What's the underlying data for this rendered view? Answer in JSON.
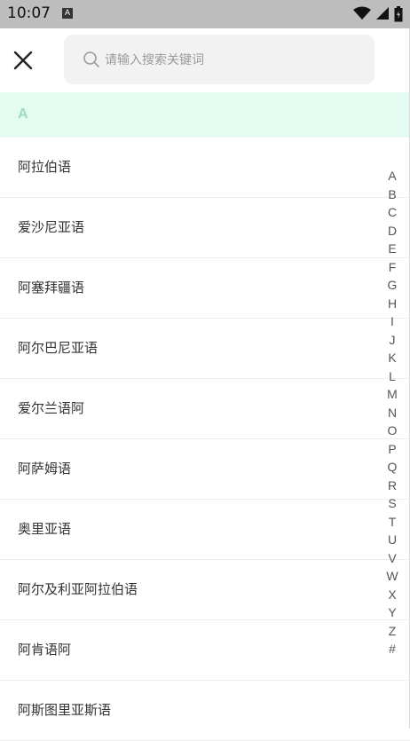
{
  "status_bar": {
    "time": "10:07",
    "notification_glyph": "A"
  },
  "search": {
    "placeholder": "请输入搜索关键词"
  },
  "section": {
    "letter": "A"
  },
  "languages": [
    "阿拉伯语",
    "爱沙尼亚语",
    "阿塞拜疆语",
    "阿尔巴尼亚语",
    "爱尔兰语阿",
    "阿萨姆语",
    "奥里亚语",
    "阿尔及利亚阿拉伯语",
    "阿肯语阿",
    "阿斯图里亚斯语"
  ],
  "index_letters": [
    "A",
    "B",
    "C",
    "D",
    "E",
    "F",
    "G",
    "H",
    "I",
    "J",
    "K",
    "L",
    "M",
    "N",
    "O",
    "P",
    "Q",
    "R",
    "S",
    "T",
    "U",
    "V",
    "W",
    "X",
    "Y",
    "Z",
    "#"
  ],
  "colors": {
    "section_bg": "#e3fbf0",
    "section_letter": "#9fd9be",
    "search_bg": "#f2f2f2"
  }
}
